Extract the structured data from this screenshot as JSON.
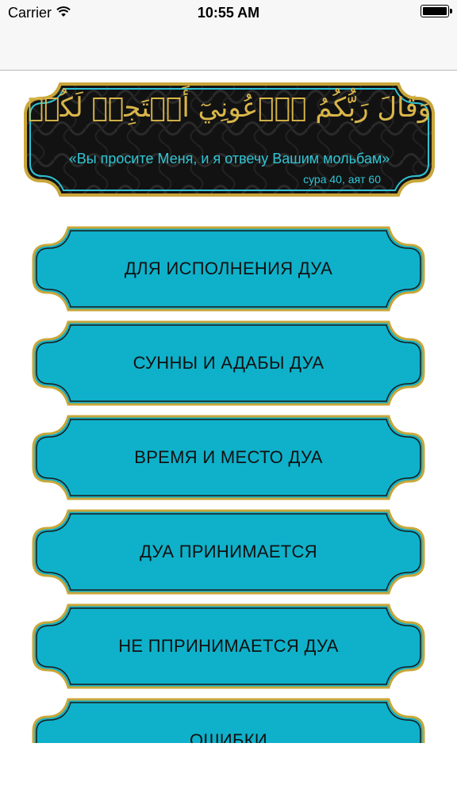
{
  "status_bar": {
    "carrier": "Carrier",
    "time": "10:55 AM"
  },
  "banner": {
    "arabic": "وَقَالَ رَبُّكُمُ ٱدۡعُونِيٓ أَسۡتَجِبۡ لَكُمۡ",
    "translation": "«Вы просите Меня, и я отвечу Вашим мольбам»",
    "reference": "сура 40, аят 60"
  },
  "menu": {
    "items": [
      {
        "label": "ДЛЯ ИСПОЛНЕНИЯ ДУА"
      },
      {
        "label": "СУННЫ И АДАБЫ ДУА"
      },
      {
        "label": "ВРЕМЯ И МЕСТО ДУА"
      },
      {
        "label": "ДУА ПРИНИМАЕТСЯ"
      },
      {
        "label": "НЕ ППРИНИМАЕТСЯ ДУА"
      },
      {
        "label": "ОШИБКИ"
      }
    ]
  },
  "colors": {
    "button_fill": "#0fb1ca",
    "frame_gold": "#c9a63a",
    "banner_bg": "#111111",
    "accent_text": "#30c6d6"
  }
}
